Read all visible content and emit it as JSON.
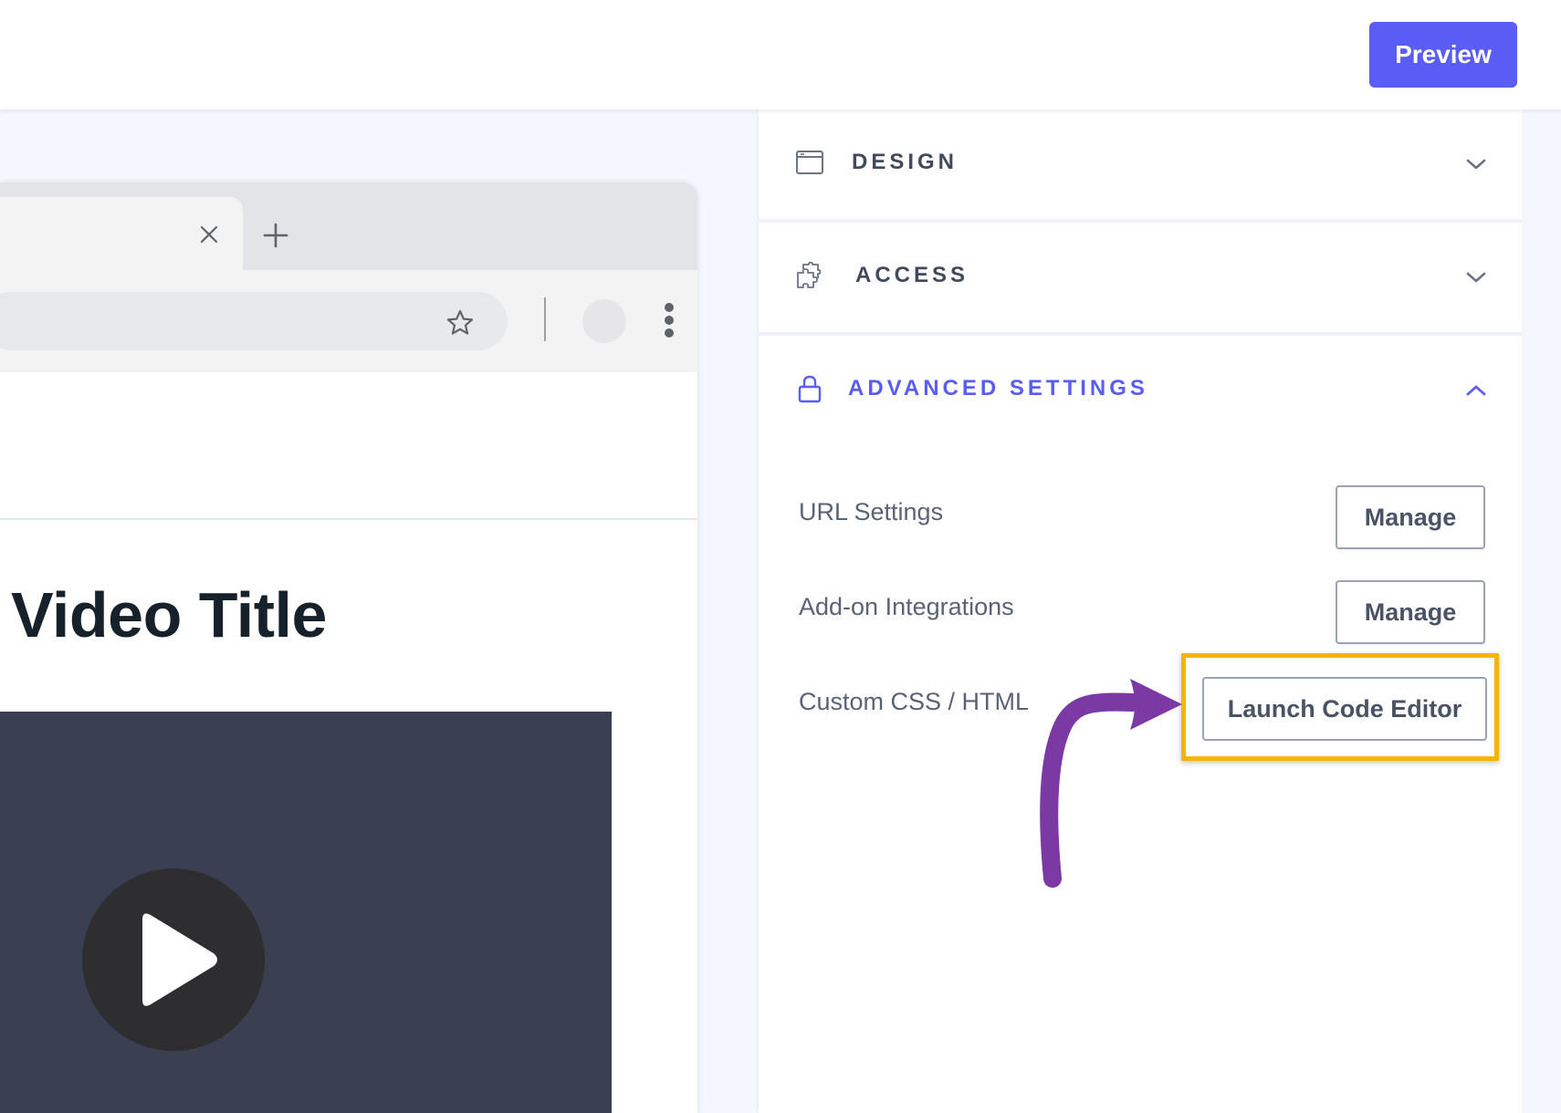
{
  "topbar": {
    "preview_label": "Preview",
    "accent_color": "#5a5cf6"
  },
  "preview_page": {
    "video_title": "Video Title",
    "icons": {
      "tab_close": "close-icon",
      "new_tab": "plus-icon",
      "bookmark": "star-icon",
      "menu": "kebab-menu-icon",
      "play": "play-icon"
    }
  },
  "sidebar": {
    "sections": [
      {
        "label": "DESIGN",
        "icon": "browser-window-icon",
        "state": "collapsed"
      },
      {
        "label": "ACCESS",
        "icon": "puzzle-piece-icon",
        "state": "collapsed"
      },
      {
        "label": "ADVANCED SETTINGS",
        "icon": "lock-icon",
        "state": "expanded"
      }
    ],
    "advanced": {
      "rows": [
        {
          "label": "URL Settings",
          "button": "Manage"
        },
        {
          "label": "Add-on Integrations",
          "button": "Manage"
        },
        {
          "label": "Custom CSS / HTML",
          "button": "Launch Code Editor"
        }
      ]
    }
  },
  "annotation": {
    "highlight_color": "#f5b400",
    "arrow_color": "#7b3aa3"
  }
}
